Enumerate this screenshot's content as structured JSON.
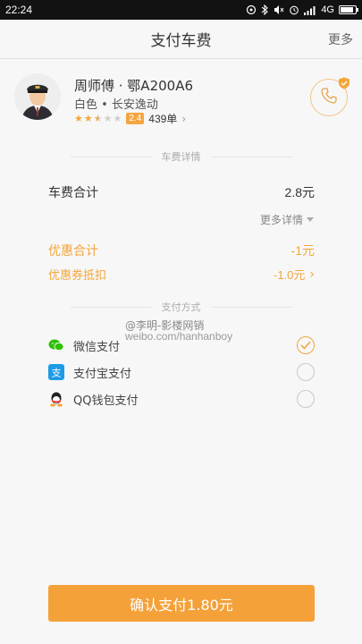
{
  "status_bar": {
    "time": "22:24",
    "network": "4G",
    "battery_level": 0.85
  },
  "header": {
    "title": "支付车费",
    "more_label": "更多"
  },
  "driver": {
    "name": "周师傅 · 鄂A200A6",
    "car": "白色 • 长安逸动",
    "stars_filled": 2.5,
    "stars_total": 5,
    "rating": "2.4",
    "orders": "439单"
  },
  "fare": {
    "section_title": "车费详情",
    "total_label": "车费合计",
    "total_value": "2.8元",
    "more_details_label": "更多详情",
    "discount_label": "优惠合计",
    "discount_value": "-1元",
    "coupon_label": "优惠券抵扣",
    "coupon_value": "-1.0元"
  },
  "payment": {
    "section_title": "支付方式",
    "methods": [
      {
        "label": "微信支付",
        "selected": true,
        "icon": "wechat-pay-icon"
      },
      {
        "label": "支付宝支付",
        "selected": false,
        "icon": "alipay-icon"
      },
      {
        "label": "QQ钱包支付",
        "selected": false,
        "icon": "qq-wallet-icon"
      }
    ]
  },
  "watermark": {
    "line1": "@李明-影楼网销",
    "line2": "weibo.com/hanhanboy"
  },
  "confirm_button_label": "确认支付1.80元",
  "colors": {
    "accent": "#f5a13a",
    "wechat": "#2dc100",
    "alipay": "#1c9be6"
  }
}
